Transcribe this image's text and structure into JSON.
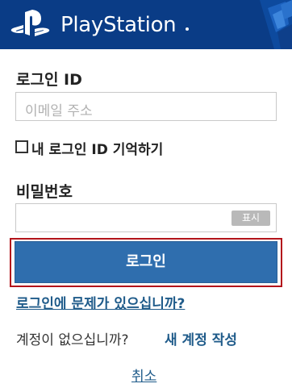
{
  "header": {
    "brand": "PlayStation",
    "brand_color": "#0a3c86"
  },
  "form": {
    "login_id_label": "로그인 ID",
    "email_placeholder": "이메일 주소",
    "remember_label": "내 로그인 ID 기억하기",
    "password_label": "비밀번호",
    "show_button": "표시",
    "login_button": "로그인",
    "login_button_color": "#2f6eae"
  },
  "links": {
    "trouble": "로그인에 문제가 있으십니까?",
    "no_account": "계정이 없으십니까?",
    "new_account": "새 계정 작성",
    "cancel": "취소"
  },
  "icons": {
    "logo": "playstation-logo-icon",
    "checkbox": "checkbox-icon"
  }
}
